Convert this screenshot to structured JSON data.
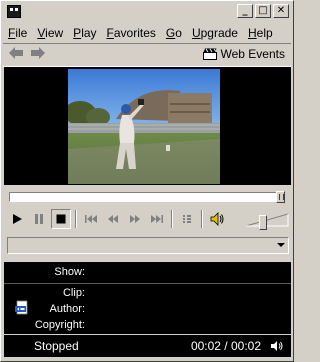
{
  "window": {
    "minimize_glyph": "_",
    "maximize_glyph": "□",
    "close_glyph": "✕"
  },
  "menu": {
    "items": [
      {
        "first": "F",
        "rest": "ile"
      },
      {
        "first": "V",
        "rest": "iew"
      },
      {
        "first": "P",
        "rest": "lay"
      },
      {
        "first": "F",
        "rest": "avorites"
      },
      {
        "first": "G",
        "rest": "o"
      },
      {
        "first": "U",
        "rest": "pgrade"
      },
      {
        "first": "H",
        "rest": "elp"
      }
    ]
  },
  "navbar": {
    "back_icon": "left-arrow-icon",
    "forward_icon": "right-arrow-icon",
    "web_events_label": "Web Events"
  },
  "video": {
    "description_icon": "video-frame-baseball"
  },
  "seek": {
    "position_fraction": 1.0
  },
  "controls": {
    "volume_fraction": 0.4
  },
  "info": {
    "show_label": "Show:",
    "clip_label": "Clip:",
    "author_label": "Author:",
    "copyright_label": "Copyright:",
    "show_value": "",
    "clip_value": "",
    "author_value": "",
    "copyright_value": ""
  },
  "status": {
    "state": "Stopped",
    "time": "00:02 / 00:02"
  },
  "colors": {
    "chrome": "#d4d0c8",
    "panel": "#000000",
    "text_light": "#ffffff"
  }
}
